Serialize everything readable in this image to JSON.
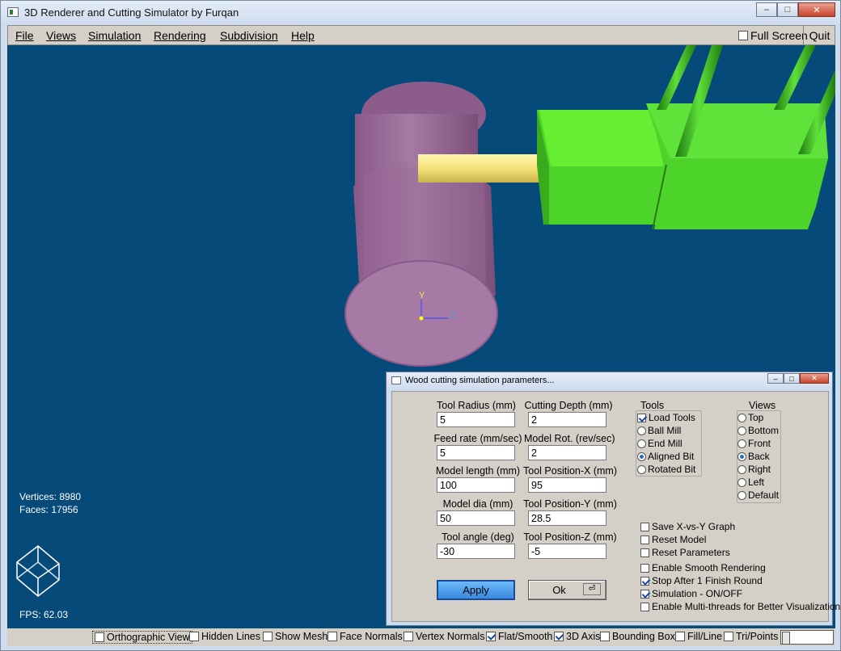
{
  "window": {
    "title": "3D Renderer and Cutting Simulator by Furqan",
    "btn_min": "–",
    "btn_max": "□",
    "btn_close": "✕"
  },
  "menu": {
    "items": [
      "File",
      "Views",
      "Simulation",
      "Rendering",
      "Subdivision",
      "Help"
    ],
    "fullscreen": "Full Screen",
    "fullscreen_checked": false,
    "quit": "Quit"
  },
  "viewport": {
    "background": "#064a7a",
    "axis": {
      "y": "Y",
      "z": "Z"
    },
    "vertices": "Vertices: 8980",
    "faces": "Faces: 17956",
    "fps": "FPS: 62.03"
  },
  "bottom": {
    "options": [
      {
        "label": "Orthographic View",
        "checked": false
      },
      {
        "label": "Hidden Lines",
        "checked": false
      },
      {
        "label": "Show Mesh",
        "checked": false
      },
      {
        "label": "Face Normals",
        "checked": false
      },
      {
        "label": "Vertex Normals",
        "checked": false
      },
      {
        "label": "Flat/Smooth",
        "checked": true
      },
      {
        "label": "3D Axis",
        "checked": true
      },
      {
        "label": "Bounding Box",
        "checked": false
      },
      {
        "label": "Fill/Line",
        "checked": false
      },
      {
        "label": "Tri/Points",
        "checked": false
      }
    ]
  },
  "dialog": {
    "title": "Wood cutting simulation parameters...",
    "fields": [
      {
        "label": "Tool Radius (mm)",
        "value": "5"
      },
      {
        "label": "Cutting Depth (mm)",
        "value": "2"
      },
      {
        "label": "Feed rate (mm/sec)",
        "value": "5"
      },
      {
        "label": "Model Rot. (rev/sec)",
        "value": "2"
      },
      {
        "label": "Model length (mm)",
        "value": "100"
      },
      {
        "label": "Tool Position-X (mm)",
        "value": "95"
      },
      {
        "label": "Model dia (mm)",
        "value": "50"
      },
      {
        "label": "Tool Position-Y (mm)",
        "value": "28.5"
      },
      {
        "label": "Tool angle (deg)",
        "value": "-30"
      },
      {
        "label": "Tool Position-Z (mm)",
        "value": "-5"
      }
    ],
    "tools": {
      "title": "Tools",
      "load_tools": {
        "label": "Load Tools",
        "checked": true
      },
      "options": [
        {
          "label": "Ball Mill",
          "selected": false
        },
        {
          "label": "End Mill",
          "selected": false
        },
        {
          "label": "Aligned Bit",
          "selected": true
        },
        {
          "label": "Rotated Bit",
          "selected": false
        }
      ]
    },
    "views": {
      "title": "Views",
      "options": [
        {
          "label": "Top",
          "selected": false
        },
        {
          "label": "Bottom",
          "selected": false
        },
        {
          "label": "Front",
          "selected": false
        },
        {
          "label": "Back",
          "selected": true
        },
        {
          "label": "Right",
          "selected": false
        },
        {
          "label": "Left",
          "selected": false
        },
        {
          "label": "Default",
          "selected": false
        }
      ]
    },
    "checks": [
      {
        "label": "Save X-vs-Y Graph",
        "checked": false
      },
      {
        "label": "Reset Model",
        "checked": false
      },
      {
        "label": "Reset Parameters",
        "checked": false
      },
      {
        "label": "Enable Smooth Rendering",
        "checked": false
      },
      {
        "label": "Stop After 1 Finish Round",
        "checked": true
      },
      {
        "label": "Simulation - ON/OFF",
        "checked": true
      },
      {
        "label": "Enable Multi-threads for Better Visualization",
        "checked": false
      }
    ],
    "apply": "Apply",
    "ok": "Ok"
  }
}
